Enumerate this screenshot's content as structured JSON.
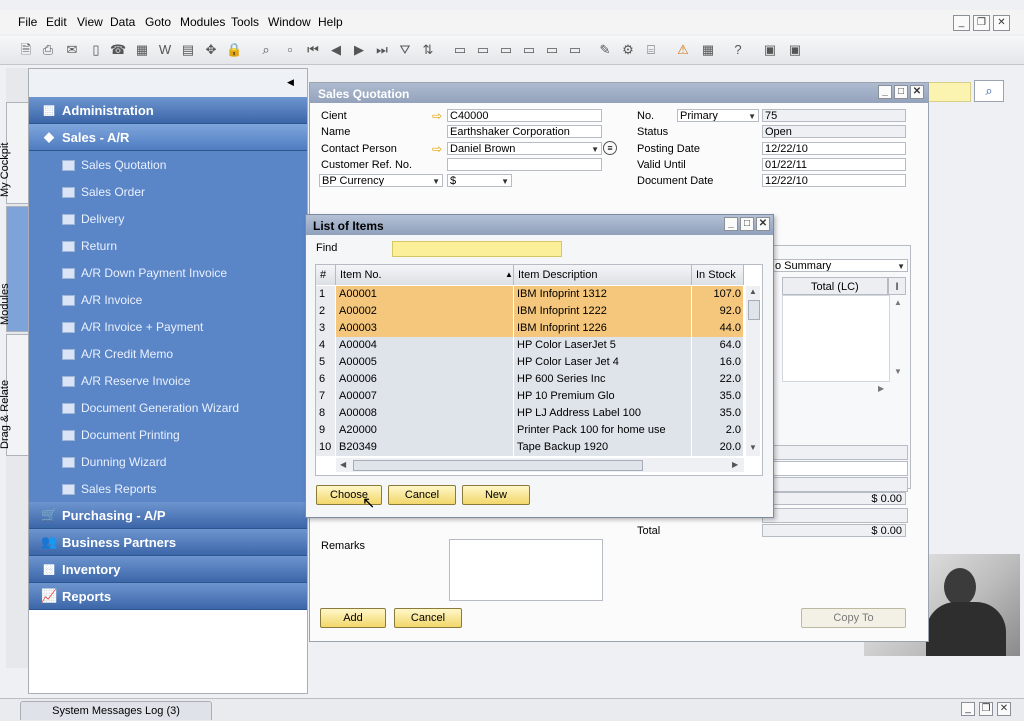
{
  "menu": [
    "File",
    "Edit",
    "View",
    "Data",
    "Goto",
    "Modules",
    "Tools",
    "Window",
    "Help"
  ],
  "side_tabs": [
    "My Cockpit",
    "Modules",
    "Drag & Relate"
  ],
  "modules": {
    "administration": "Administration",
    "sales": "Sales - A/R",
    "sales_items": [
      "Sales Quotation",
      "Sales Order",
      "Delivery",
      "Return",
      "A/R Down Payment Invoice",
      "A/R Invoice",
      "A/R Invoice + Payment",
      "A/R Credit Memo",
      "A/R Reserve Invoice",
      "Document Generation Wizard",
      "Document Printing",
      "Dunning Wizard",
      "Sales Reports"
    ],
    "purchasing": "Purchasing - A/P",
    "business_partners": "Business Partners",
    "inventory": "Inventory",
    "reports": "Reports"
  },
  "sales_quotation": {
    "title": "Sales Quotation",
    "client_label": "Cient",
    "client_value": "C40000",
    "name_label": "Name",
    "name_value": "Earthshaker Corporation",
    "contact_label": "Contact Person",
    "contact_value": "Daniel Brown",
    "custref_label": "Customer Ref. No.",
    "custref_value": "",
    "currency_select": "BP Currency",
    "currency_value": "$",
    "no_label": "No.",
    "no_series": "Primary",
    "no_value": "75",
    "status_label": "Status",
    "status_value": "Open",
    "posting_label": "Posting Date",
    "posting_value": "12/22/10",
    "valid_label": "Valid Until",
    "valid_value": "01/22/11",
    "docdate_label": "Document Date",
    "docdate_value": "12/22/10",
    "summary_select": "o Summary",
    "total_lc_header": "Total (LC)",
    "i_header": "I",
    "amount1": "$ 0.00",
    "total_label": "Total",
    "total_value": "$ 0.00",
    "remarks_label": "Remarks",
    "add_button": "Add",
    "cancel_button": "Cancel",
    "copyto_button": "Copy To"
  },
  "list_of_items": {
    "title": "List of Items",
    "find_label": "Find",
    "find_value": "",
    "columns": [
      "#",
      "Item No.",
      "Item Description",
      "In Stock"
    ],
    "rows": [
      {
        "n": "1",
        "item": "A00001",
        "desc": "IBM Infoprint 1312",
        "stock": "107.0",
        "sel": true
      },
      {
        "n": "2",
        "item": "A00002",
        "desc": "IBM Infoprint 1222",
        "stock": "92.0",
        "sel": true
      },
      {
        "n": "3",
        "item": "A00003",
        "desc": "IBM Infoprint 1226",
        "stock": "44.0",
        "sel": true
      },
      {
        "n": "4",
        "item": "A00004",
        "desc": "HP Color LaserJet 5",
        "stock": "64.0",
        "sel": false
      },
      {
        "n": "5",
        "item": "A00005",
        "desc": "HP Color Laser Jet 4",
        "stock": "16.0",
        "sel": false
      },
      {
        "n": "6",
        "item": "A00006",
        "desc": "HP 600 Series Inc",
        "stock": "22.0",
        "sel": false
      },
      {
        "n": "7",
        "item": "A00007",
        "desc": "HP 10 Premium Glo",
        "stock": "35.0",
        "sel": false
      },
      {
        "n": "8",
        "item": "A00008",
        "desc": "HP LJ Address Label 100",
        "stock": "35.0",
        "sel": false
      },
      {
        "n": "9",
        "item": "A20000",
        "desc": "Printer Pack 100 for home use",
        "stock": "2.0",
        "sel": false
      },
      {
        "n": "10",
        "item": "B20349",
        "desc": "Tape Backup 1920",
        "stock": "20.0",
        "sel": false
      }
    ],
    "choose_button": "Choose",
    "cancel_button": "Cancel",
    "new_button": "New"
  },
  "status_bar": {
    "messages_tab": "System Messages Log (3)"
  },
  "colors": {
    "module_header": "#3b66a8",
    "module_item": "#5a85c6",
    "selected_row": "#f5c77c",
    "button": "#f2d76b"
  }
}
